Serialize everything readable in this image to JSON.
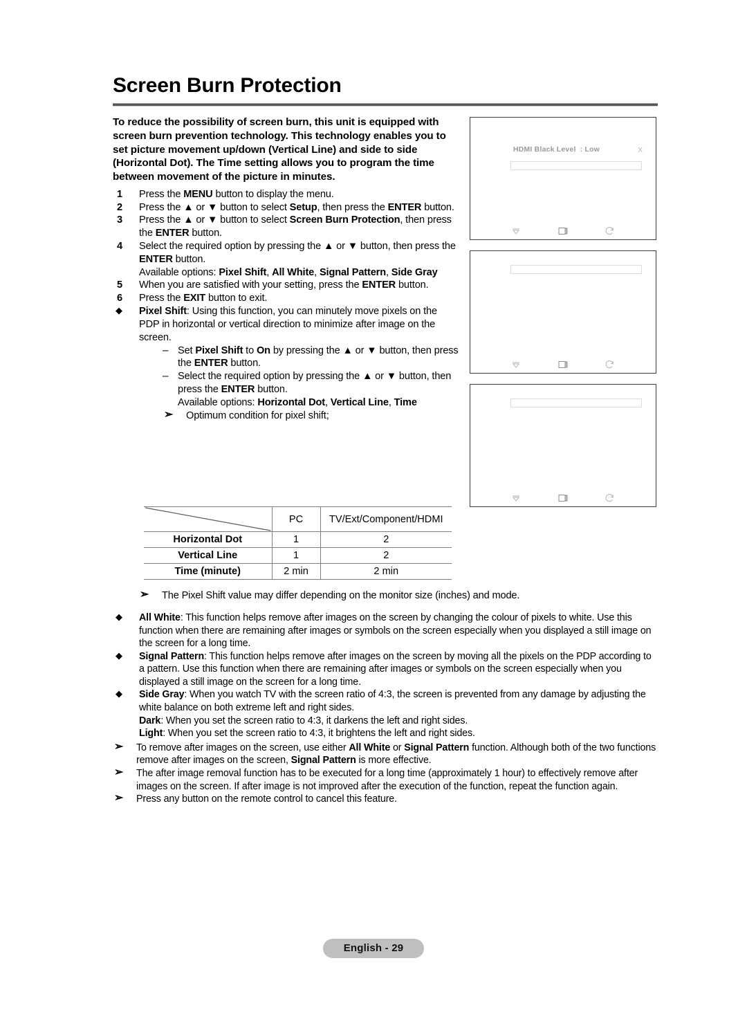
{
  "page": {
    "title": "Screen Burn Protection",
    "footer_label": "English - 29"
  },
  "intro": "To reduce the possibility of screen burn, this unit is equipped with screen burn prevention technology. This technology enables you to set picture movement up/down (Vertical Line) and side to side (Horizontal Dot). The Time setting allows you to program the time between movement of the picture in minutes.",
  "steps": [
    {
      "num": "1",
      "html": "Press the <b>MENU</b> button to display the menu."
    },
    {
      "num": "2",
      "html": "Press the ▲ or ▼ button to select <b>Setup</b>, then press the <b>ENTER</b> button."
    },
    {
      "num": "3",
      "html": "Press the ▲ or ▼ button to select <b>Screen Burn Protection</b>, then press the <b>ENTER</b> button."
    },
    {
      "num": "4",
      "html": "Select the required option by pressing the ▲ or ▼ button, then press the <b>ENTER</b> button.<span class=\"sub-note\">Available options: <b>Pixel Shift</b>, <b>All White</b>, <b>Signal Pattern</b>, <b>Side Gray</b></span>"
    },
    {
      "num": "5",
      "html": "When you are satisfied with your setting, press the <b>ENTER</b> button."
    },
    {
      "num": "6",
      "html": "Press the <b>EXIT</b> button to exit."
    }
  ],
  "pixel_shift": {
    "bullet": "◆",
    "html": "<b>Pixel Shift</b>: Using this function, you can minutely move pixels on the PDP in horizontal or vertical direction to minimize after image on the screen.",
    "sub_items": [
      {
        "dash": "–",
        "html": "Set <b>Pixel Shift</b> to <b>On</b> by pressing the ▲ or ▼ button, then press the <b>ENTER</b> button."
      },
      {
        "dash": "–",
        "html": "Select the required option by pressing the ▲ or ▼ button, then press the <b>ENTER</b> button."
      }
    ],
    "available_html": "Available options: <b>Horizontal Dot</b>, <b>Vertical Line</b>, <b>Time</b>",
    "optimum_note": "Optimum condition for pixel shift;"
  },
  "table": {
    "corner_label": "",
    "columns": [
      "PC",
      "TV/Ext/Component/HDMI"
    ],
    "rows": [
      {
        "label": "Horizontal Dot",
        "pc": "1",
        "tv": "2"
      },
      {
        "label": "Vertical Line",
        "pc": "1",
        "tv": "2"
      },
      {
        "label": "Time (minute)",
        "pc": "2 min",
        "tv": "2 min"
      }
    ],
    "after_note": "The Pixel Shift value may differ depending on the monitor size (inches) and mode."
  },
  "features": [
    {
      "bullet": "◆",
      "html": "<b>All White</b>: This function helps remove after images on the screen by changing the colour of pixels to white. Use this function when there are remaining after images or symbols on the screen especially when you displayed a still image on the screen for a long time."
    },
    {
      "bullet": "◆",
      "html": "<b>Signal Pattern</b>: This function helps remove after images on the screen by moving all the pixels on the PDP according to a pattern. Use this function when there are remaining after images or symbols on the screen especially when you displayed a still image on the screen for a long time."
    },
    {
      "bullet": "◆",
      "html": "<b>Side Gray</b>: When you watch TV with the screen ratio of 4:3, the screen is prevented from any damage by adjusting the white balance on both extreme left and right sides.<br><b>Dark</b>: When you set the screen ratio to 4:3, it darkens the left and right sides.<br><b>Light</b>: When you set the screen ratio to 4:3, it brightens the left and right sides."
    }
  ],
  "notes": [
    {
      "arrow": "➢",
      "html": "To remove after images on the screen, use either <b>All White</b> or <b>Signal Pattern</b> function. Although both of the two functions remove after images on the screen, <b>Signal Pattern</b> is more effective."
    },
    {
      "arrow": "➢",
      "html": "The after image removal function has to be executed for a long time (approximately 1 hour) to effectively remove after images on the screen. If after image is not improved after the execution of the function, repeat the function again."
    },
    {
      "arrow": "➢",
      "html": "Press any button on the remote control to cancel this feature."
    }
  ],
  "menu_screens": [
    {
      "title": "HDMI Black Level",
      "value": ": Low",
      "close": "X",
      "has_title": true,
      "footer_icons": [
        "move-down-icon",
        "enter-icon",
        "return-icon"
      ]
    },
    {
      "title": "",
      "value": "",
      "close": "",
      "has_title": false,
      "footer_icons": [
        "move-down-icon",
        "enter-icon",
        "return-icon"
      ]
    },
    {
      "title": "",
      "value": "",
      "close": "",
      "has_title": false,
      "footer_icons": [
        "move-down-icon",
        "enter-icon",
        "return-icon"
      ]
    }
  ],
  "colors": {
    "rule": "#58585a",
    "table_line": "#7c7c7e",
    "menu_border": "#3a3a3a",
    "menu_text": "#9a9a9e",
    "footer_pill": "#bfbfbf"
  }
}
